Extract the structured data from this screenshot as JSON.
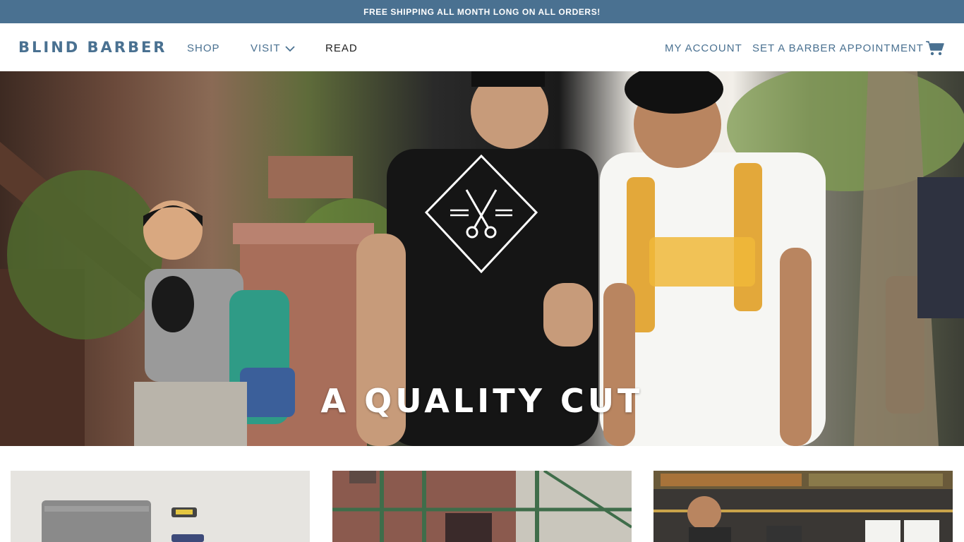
{
  "promo": {
    "text": "FREE SHIPPING ALL MONTH LONG ON ALL ORDERS!"
  },
  "header": {
    "logo": "BLIND BARBER",
    "nav": {
      "shop": "SHOP",
      "visit": "VISIT",
      "read": "READ"
    },
    "account": "MY ACCOUNT",
    "appointment": "SET A BARBER APPOINTMENT",
    "cart_icon": "cart-icon"
  },
  "hero": {
    "title": "A QUALITY CUT",
    "logo_icon": "scissors-diamond-icon"
  },
  "colors": {
    "brand": "#4a7191",
    "promo_bg": "#4a7191",
    "read_link": "#222222"
  }
}
